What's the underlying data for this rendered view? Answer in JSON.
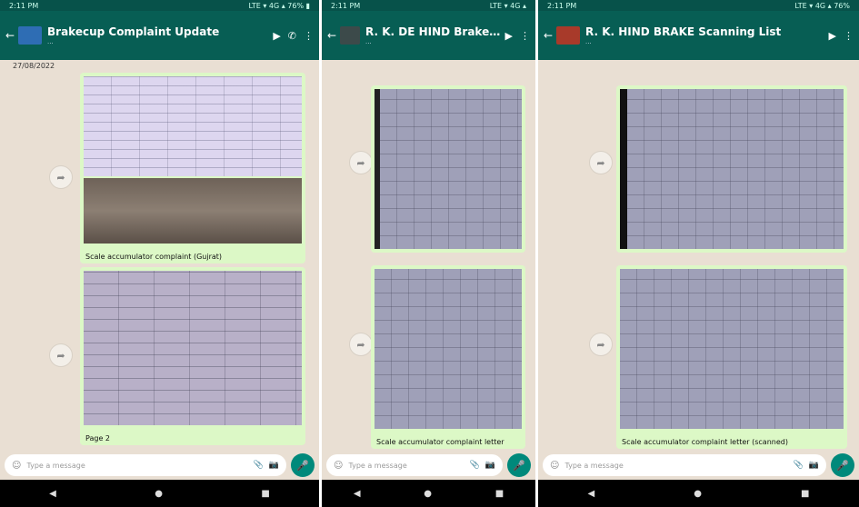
{
  "screens": [
    {
      "status": {
        "left": "2:11 PM",
        "right": "LTE ▾ 4G ▴ 76% ▮"
      },
      "title": "Brakecup Complaint Update",
      "subtitle": "...",
      "date_label": "27/08/2022",
      "captions": [
        "Scale accumulator complaint (Gujrat)",
        "Page 2"
      ],
      "placeholder": "Type a message",
      "colors": {
        "avatar": "#2e6db4"
      }
    },
    {
      "status": {
        "left": "2:11 PM",
        "right": "LTE ▾ 4G ▴"
      },
      "title": "R. K. DE HIND Brakecup",
      "subtitle": "...",
      "captions": [
        "Scale accumulator complaint letter"
      ],
      "placeholder": "Type a message",
      "colors": {
        "avatar": "#3c4a4a"
      }
    },
    {
      "status": {
        "left": "2:11 PM",
        "right": "LTE ▾ 4G ▴ 76%"
      },
      "title": "R. K. HIND BRAKE Scanning List",
      "subtitle": "...",
      "captions": [
        "Scale accumulator complaint letter (scanned)"
      ],
      "placeholder": "Type a message",
      "colors": {
        "avatar": "#a83a2a"
      }
    }
  ],
  "nav": {
    "back": "◀",
    "home": "●",
    "recents": "■"
  },
  "icons": {
    "mic": "🎤",
    "attach": "📎",
    "camera": "📷",
    "emoji": "☺",
    "video": "▶",
    "call": "✆",
    "menu": "⋮"
  }
}
